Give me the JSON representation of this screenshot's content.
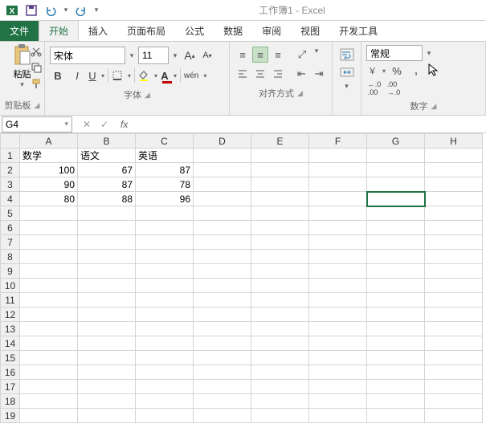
{
  "title": "工作簿1 - Excel",
  "tabs": {
    "file": "文件",
    "items": [
      "开始",
      "插入",
      "页面布局",
      "公式",
      "数据",
      "审阅",
      "视图",
      "开发工具"
    ],
    "active": 0
  },
  "ribbon": {
    "clipboard": {
      "label": "剪贴板",
      "paste": "粘贴"
    },
    "font": {
      "label": "字体",
      "name": "宋体",
      "size": "11",
      "bold": "B",
      "italic": "I",
      "underline": "U",
      "phonetic": "wén"
    },
    "align": {
      "label": "对齐方式"
    },
    "number": {
      "label": "数字",
      "format": "常规",
      "percent": "%",
      "comma": ",",
      "inc": ".00→.0",
      "dec": ".0→.00"
    }
  },
  "namebox": "G4",
  "fx": "fx",
  "columns": [
    "A",
    "B",
    "C",
    "D",
    "E",
    "F",
    "G",
    "H"
  ],
  "rows": 19,
  "data": {
    "A1": "数学",
    "B1": "语文",
    "C1": "英语",
    "A2": "100",
    "B2": "67",
    "C2": "87",
    "A3": "90",
    "B3": "87",
    "C3": "78",
    "A4": "80",
    "B4": "88",
    "C4": "96"
  },
  "textCells": [
    "A1",
    "B1",
    "C1"
  ],
  "selectedCell": "G4"
}
